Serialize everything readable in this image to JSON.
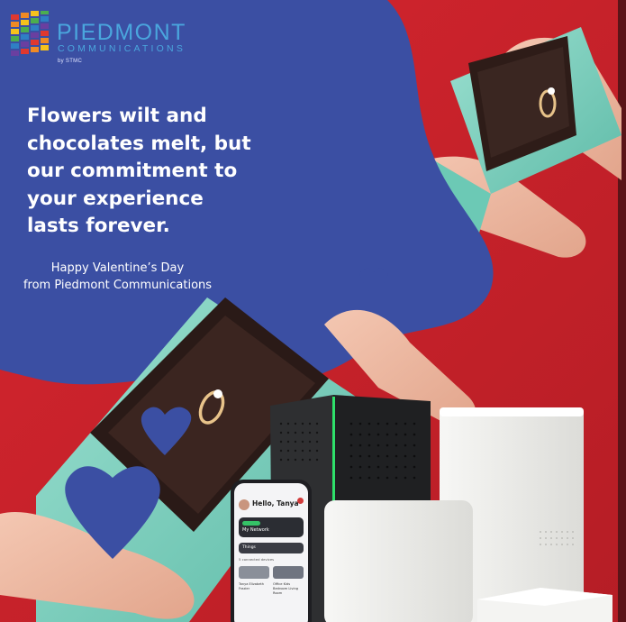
{
  "brand": {
    "name": "PIEDMONT",
    "subtitle": "COMMUNICATIONS",
    "by_line": "by STMC",
    "logo_colors": [
      "#e0382f",
      "#f08a24",
      "#f6c21c",
      "#4cae4f",
      "#2f7fc4",
      "#6a3fa0"
    ]
  },
  "headline": [
    "Flowers wilt and",
    "chocolates melt, but",
    "our commitment to",
    "your experience",
    "lasts forever."
  ],
  "greeting": [
    "Happy Valentine’s Day",
    "from Piedmont Communications"
  ],
  "phone": {
    "greeting": "Hello, Tanya",
    "network_label": "My Network",
    "things_label": "Things",
    "devices_label": "5 connected devices",
    "card_left": "Tanya Elizabeth Frazier",
    "card_right": "Office Kids Bedroom Living Room"
  },
  "colors": {
    "background_red": "#c8232b",
    "blob_blue": "#3b4fa3",
    "box_teal": "#7fd0bf",
    "box_dark": "#2a1a17",
    "headline_text": "#ffffff",
    "brand_text": "#4aa6dd"
  }
}
